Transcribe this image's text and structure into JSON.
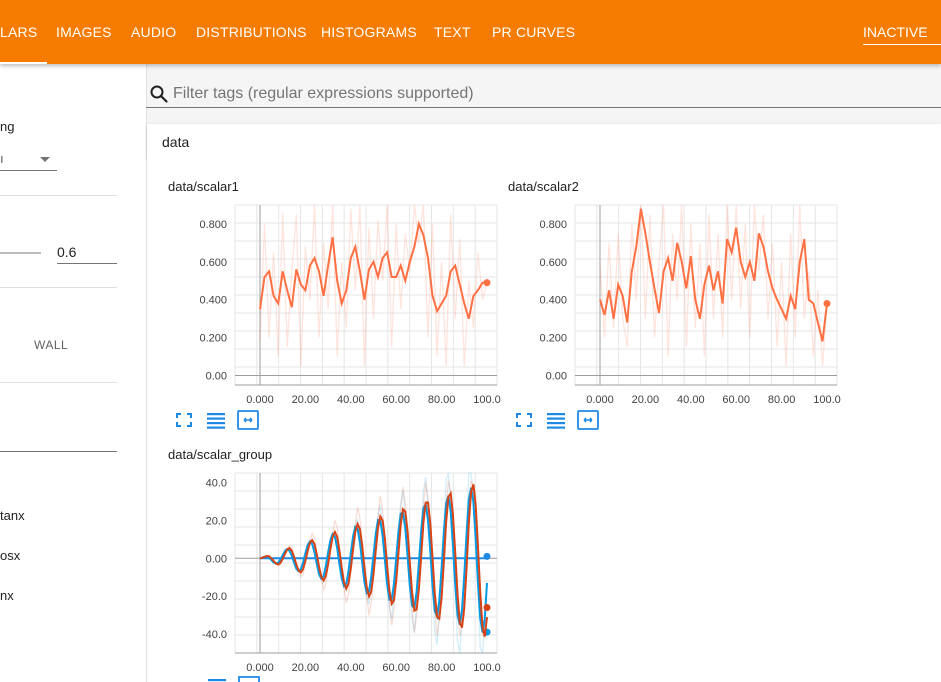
{
  "topbar": {
    "tabs": [
      {
        "label": "LARS",
        "active": true
      },
      {
        "label": "IMAGES"
      },
      {
        "label": "AUDIO"
      },
      {
        "label": "DISTRIBUTIONS"
      },
      {
        "label": "HISTOGRAMS"
      },
      {
        "label": "TEXT"
      },
      {
        "label": "PR CURVES"
      }
    ],
    "inactive_label": "INACTIVE",
    "color": "#f57c00"
  },
  "sidebar": {
    "ng_label": "ng",
    "dropdown_value": "ı",
    "smoothing_value": "0.6",
    "wall_label": "WALL",
    "runs": [
      "tanx",
      "osx",
      "nx"
    ]
  },
  "search": {
    "placeholder": "Filter tags (regular expressions supported)",
    "icon": "search-icon"
  },
  "category": {
    "title": "data"
  },
  "chart_data": [
    {
      "type": "line",
      "title": "data/scalar1",
      "xlim": [
        0,
        100
      ],
      "ylim": [
        -0.05,
        0.9
      ],
      "xticks": [
        "0.000",
        "20.00",
        "40.00",
        "60.00",
        "80.00",
        "100.0"
      ],
      "yticks": [
        "0.800",
        "0.600",
        "0.400",
        "0.200",
        "0.00"
      ],
      "series": [
        {
          "color": "#ff7043",
          "x": [
            0,
            2,
            4,
            6,
            8,
            10,
            12,
            14,
            16,
            18,
            20,
            22,
            24,
            26,
            28,
            30,
            32,
            34,
            36,
            38,
            40,
            42,
            44,
            46,
            48,
            50,
            52,
            54,
            56,
            58,
            60,
            62,
            64,
            66,
            68,
            70,
            72,
            74,
            76,
            78,
            80,
            82,
            84,
            86,
            88,
            90,
            92,
            94,
            96,
            98,
            100
          ],
          "smoothed": [
            0.35,
            0.52,
            0.55,
            0.42,
            0.38,
            0.55,
            0.45,
            0.36,
            0.56,
            0.48,
            0.45,
            0.58,
            0.62,
            0.55,
            0.42,
            0.58,
            0.73,
            0.5,
            0.38,
            0.45,
            0.62,
            0.68,
            0.55,
            0.4,
            0.56,
            0.6,
            0.52,
            0.62,
            0.65,
            0.52,
            0.52,
            0.58,
            0.5,
            0.6,
            0.68,
            0.8,
            0.74,
            0.62,
            0.42,
            0.34,
            0.38,
            0.42,
            0.55,
            0.58,
            0.48,
            0.38,
            0.3,
            0.42,
            0.45,
            0.49,
            0.49
          ],
          "raw": [
            0.18,
            0.8,
            0.2,
            0.65,
            0.1,
            0.86,
            0.15,
            0.55,
            0.85,
            0.05,
            0.68,
            0.4,
            0.9,
            0.2,
            0.7,
            0.35,
            0.92,
            0.1,
            0.6,
            0.25,
            0.88,
            0.45,
            0.9,
            0.05,
            0.78,
            0.3,
            0.82,
            0.5,
            0.95,
            0.15,
            0.8,
            0.35,
            0.75,
            0.55,
            0.9,
            0.7,
            0.95,
            0.2,
            0.8,
            0.1,
            0.6,
            0.05,
            0.85,
            0.3,
            0.72,
            0.05,
            0.5,
            0.25,
            0.65,
            0.4,
            0.49
          ]
        }
      ]
    },
    {
      "type": "line",
      "title": "data/scalar2",
      "xlim": [
        0,
        100
      ],
      "ylim": [
        -0.05,
        0.9
      ],
      "xticks": [
        "0.000",
        "20.00",
        "40.00",
        "60.00",
        "80.00",
        "100.0"
      ],
      "yticks": [
        "0.800",
        "0.600",
        "0.400",
        "0.200",
        "0.00"
      ],
      "series": [
        {
          "color": "#ff7043",
          "x": [
            0,
            2,
            4,
            6,
            8,
            10,
            12,
            14,
            16,
            18,
            20,
            22,
            24,
            26,
            28,
            30,
            32,
            34,
            36,
            38,
            40,
            42,
            44,
            46,
            48,
            50,
            52,
            54,
            56,
            58,
            60,
            62,
            64,
            66,
            68,
            70,
            72,
            74,
            76,
            78,
            80,
            82,
            84,
            86,
            88,
            90,
            92,
            94,
            96,
            98,
            100
          ],
          "smoothed": [
            0.4,
            0.32,
            0.45,
            0.3,
            0.48,
            0.42,
            0.28,
            0.55,
            0.68,
            0.88,
            0.75,
            0.6,
            0.46,
            0.33,
            0.55,
            0.62,
            0.5,
            0.7,
            0.6,
            0.46,
            0.63,
            0.4,
            0.3,
            0.48,
            0.58,
            0.45,
            0.55,
            0.38,
            0.72,
            0.65,
            0.78,
            0.6,
            0.52,
            0.6,
            0.5,
            0.75,
            0.68,
            0.55,
            0.46,
            0.4,
            0.35,
            0.3,
            0.42,
            0.35,
            0.6,
            0.72,
            0.4,
            0.38,
            0.28,
            0.18,
            0.38
          ],
          "raw": [
            0.6,
            0.2,
            0.7,
            0.25,
            0.75,
            0.3,
            0.15,
            0.8,
            0.4,
            0.95,
            0.3,
            0.85,
            0.2,
            0.6,
            0.9,
            0.1,
            0.75,
            0.4,
            0.95,
            0.15,
            0.8,
            0.25,
            0.7,
            0.1,
            0.85,
            0.3,
            0.75,
            0.2,
            0.95,
            0.4,
            0.9,
            0.35,
            0.8,
            0.2,
            0.95,
            0.55,
            0.85,
            0.3,
            0.7,
            0.15,
            0.6,
            0.05,
            0.75,
            0.2,
            0.9,
            0.3,
            0.55,
            0.1,
            0.45,
            0.05,
            0.38
          ]
        }
      ]
    },
    {
      "type": "line",
      "title": "data/scalar_group",
      "xlim": [
        0,
        100
      ],
      "ylim": [
        -50,
        45
      ],
      "xticks": [
        "0.000",
        "20.00",
        "40.00",
        "60.00",
        "80.00",
        "100.0"
      ],
      "yticks": [
        "40.0",
        "20.0",
        "0.00",
        "-20.0",
        "-40.0"
      ],
      "series": [
        {
          "color": "#1e88e5",
          "shape": "flat",
          "amp_per_step": 0,
          "final": 1
        },
        {
          "color": "#039be5",
          "shape": "oscillation",
          "amp_per_step": 0.4,
          "phase": 0.5,
          "final": -39
        },
        {
          "color": "#d84315",
          "shape": "oscillation",
          "amp_per_step": 0.42,
          "phase": 0,
          "final": -26
        }
      ]
    }
  ]
}
